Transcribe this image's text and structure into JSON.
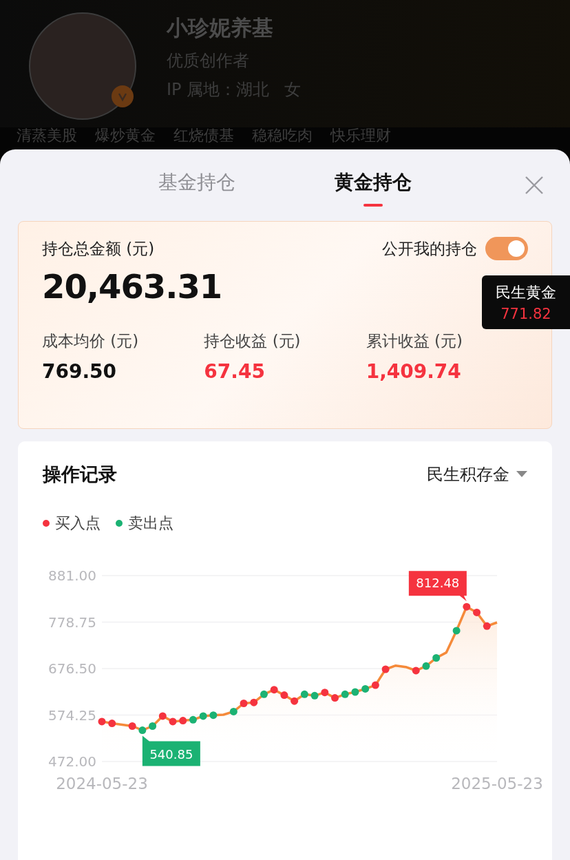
{
  "profile": {
    "name": "小珍妮养基",
    "title": "优质创作者",
    "location": "IP 属地：湖北",
    "gender": "女",
    "verified": true,
    "tags": [
      "清蒸美股",
      "爆炒黄金",
      "红烧债基",
      "稳稳吃肉",
      "快乐理财"
    ]
  },
  "tabs": [
    {
      "label": "基金持仓",
      "selected": false
    },
    {
      "label": "黄金持仓",
      "selected": true
    }
  ],
  "summary": {
    "total_label": "持仓总金额 (元)",
    "total": "20,463.31",
    "public_label": "公开我的持仓",
    "public_on": true,
    "stats": [
      {
        "label": "成本均价 (元)",
        "value": "769.50",
        "kind": "neutral"
      },
      {
        "label": "持仓收益 (元)",
        "value": "67.45",
        "kind": "gain"
      },
      {
        "label": "累计收益 (元)",
        "value": "1,409.74",
        "kind": "gain"
      }
    ]
  },
  "tooltip": {
    "name": "民生黄金",
    "price": "771.82"
  },
  "records": {
    "title": "操作记录",
    "selector": "民生积存金",
    "chart_data": {
      "type": "area",
      "grid": true,
      "categories": [
        "2024-05-23",
        null,
        null,
        null,
        null,
        null,
        null,
        null,
        null,
        null,
        null,
        null,
        null,
        null,
        null,
        null,
        null,
        null,
        null,
        null,
        null,
        null,
        null,
        null,
        null,
        null,
        null,
        null,
        null,
        null,
        null,
        null,
        null,
        null,
        null,
        null,
        null,
        null,
        null,
        "2025-05-23"
      ],
      "ylim": [
        472,
        881
      ],
      "yticks": [
        {
          "value": 881,
          "label": "881.00"
        },
        {
          "value": 778.75,
          "label": "778.75"
        },
        {
          "value": 676.5,
          "label": "676.50"
        },
        {
          "value": 574.25,
          "label": "574.25"
        },
        {
          "value": 472,
          "label": "472.00"
        }
      ],
      "series": [
        {
          "color": "#f58a3a",
          "values": [
            560,
            556,
            553,
            550,
            540.85,
            550,
            572,
            560,
            562,
            564,
            572,
            574,
            575,
            582,
            600,
            602,
            620,
            630,
            618,
            605,
            620,
            617,
            624,
            612,
            620,
            625,
            632,
            640,
            675,
            683,
            680,
            672,
            682,
            700,
            712,
            760,
            812.48,
            800,
            770,
            778
          ]
        },
        {
          "name": "买入点",
          "type": "scatter",
          "color": "#f5333f",
          "values": [
            560,
            556,
            null,
            550,
            null,
            null,
            572,
            560,
            562,
            null,
            null,
            null,
            null,
            null,
            600,
            602,
            null,
            630,
            618,
            605,
            null,
            null,
            624,
            612,
            null,
            null,
            null,
            640,
            675,
            null,
            null,
            672,
            null,
            null,
            null,
            null,
            812.48,
            800,
            770,
            null
          ]
        },
        {
          "name": "卖出点",
          "type": "scatter",
          "color": "#1bb273",
          "values": [
            null,
            null,
            null,
            null,
            540.85,
            550,
            null,
            null,
            null,
            564,
            572,
            574,
            null,
            582,
            null,
            null,
            620,
            null,
            null,
            null,
            620,
            617,
            null,
            null,
            620,
            625,
            632,
            null,
            null,
            null,
            null,
            null,
            682,
            700,
            null,
            760,
            null,
            null,
            null,
            null
          ]
        }
      ],
      "annotations": [
        "812.48",
        "540.85"
      ]
    }
  }
}
